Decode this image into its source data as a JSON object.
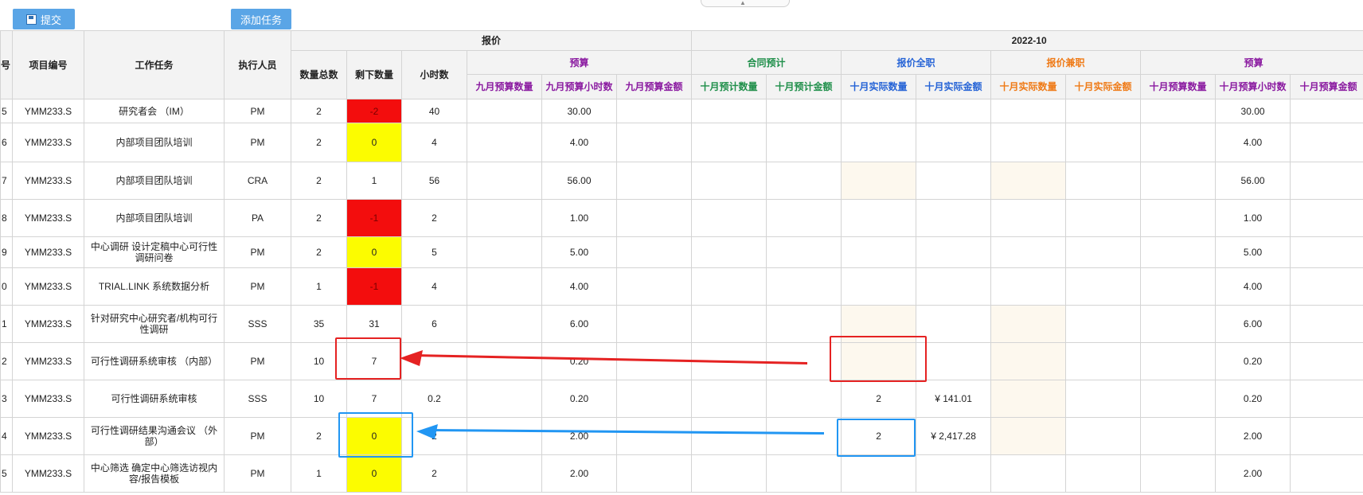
{
  "toolbar": {
    "submit_label": "提交",
    "add_task_label": "添加任务"
  },
  "header": {
    "col_no": "号",
    "col_project": "项目编号",
    "col_task": "工作任务",
    "col_exec": "执行人员",
    "group_quote": "报价",
    "group_period": "2022-10",
    "quote_total": "数量总数",
    "quote_remain": "剩下数量",
    "quote_hours": "小时数",
    "sep_budget": "预算",
    "sep_budget_count": "九月预算数量",
    "sep_budget_hours": "九月预算小时数",
    "sep_budget_amount": "九月预算金额",
    "contract_est": "合同预计",
    "oct_est_count": "十月预计数量",
    "oct_est_amount": "十月预计金额",
    "quote_fulltime": "报价全职",
    "oct_actual_count_ft": "十月实际数量",
    "oct_actual_amount_ft": "十月实际金额",
    "quote_parttime": "报价兼职",
    "oct_actual_count_pt": "十月实际数量",
    "oct_actual_amount_pt": "十月实际金额",
    "oct_budget": "预算",
    "oct_budget_count": "十月预算数量",
    "oct_budget_hours": "十月预算小时数",
    "oct_budget_amount": "十月预算金额"
  },
  "rows": [
    {
      "idx": "5",
      "project": "YMM233.S",
      "task": "研究者会 （IM）",
      "exec": "PM",
      "total": "2",
      "remain": "-2",
      "hours": "40",
      "sep_hours": "30.00",
      "ft_count": "",
      "ft_amount": "",
      "oct_hours": "30.00"
    },
    {
      "idx": "6",
      "project": "YMM233.S",
      "task": "内部项目团队培训",
      "exec": "PM",
      "total": "2",
      "remain": "0",
      "hours": "4",
      "sep_hours": "4.00",
      "ft_count": "",
      "ft_amount": "",
      "oct_hours": "4.00"
    },
    {
      "idx": "7",
      "project": "YMM233.S",
      "task": "内部项目团队培训",
      "exec": "CRA",
      "total": "2",
      "remain": "1",
      "hours": "56",
      "sep_hours": "56.00",
      "ft_count": "",
      "ft_amount": "",
      "oct_hours": "56.00"
    },
    {
      "idx": "8",
      "project": "YMM233.S",
      "task": "内部项目团队培训",
      "exec": "PA",
      "total": "2",
      "remain": "-1",
      "hours": "2",
      "sep_hours": "1.00",
      "ft_count": "",
      "ft_amount": "",
      "oct_hours": "1.00"
    },
    {
      "idx": "9",
      "project": "YMM233.S",
      "task": "中心调研 设计定稿中心可行性调研问卷",
      "exec": "PM",
      "total": "2",
      "remain": "0",
      "hours": "5",
      "sep_hours": "5.00",
      "ft_count": "",
      "ft_amount": "",
      "oct_hours": "5.00"
    },
    {
      "idx": "0",
      "project": "YMM233.S",
      "task": "TRIAL.LINK 系统数据分析",
      "exec": "PM",
      "total": "1",
      "remain": "-1",
      "hours": "4",
      "sep_hours": "4.00",
      "ft_count": "",
      "ft_amount": "",
      "oct_hours": "4.00"
    },
    {
      "idx": "1",
      "project": "YMM233.S",
      "task": "针对研究中心研究者/机构可行性调研",
      "exec": "SSS",
      "total": "35",
      "remain": "31",
      "hours": "6",
      "sep_hours": "6.00",
      "ft_count": "",
      "ft_amount": "",
      "oct_hours": "6.00"
    },
    {
      "idx": "2",
      "project": "YMM233.S",
      "task": "可行性调研系统审核 （内部）",
      "exec": "PM",
      "total": "10",
      "remain": "7",
      "hours": "",
      "sep_hours": "0.20",
      "ft_count": "",
      "ft_amount": "",
      "oct_hours": "0.20"
    },
    {
      "idx": "3",
      "project": "YMM233.S",
      "task": "可行性调研系统审核",
      "exec": "SSS",
      "total": "10",
      "remain": "7",
      "hours": "0.2",
      "sep_hours": "0.20",
      "ft_count": "2",
      "ft_amount": "¥ 141.01",
      "oct_hours": "0.20"
    },
    {
      "idx": "4",
      "project": "YMM233.S",
      "task": "可行性调研结果沟通会议 （外部）",
      "exec": "PM",
      "total": "2",
      "remain": "0",
      "hours": "2",
      "sep_hours": "2.00",
      "ft_count": "2",
      "ft_amount": "¥ 2,417.28",
      "oct_hours": "2.00"
    },
    {
      "idx": "5",
      "project": "YMM233.S",
      "task": "中心筛选 确定中心筛选访视内容/报告模板",
      "exec": "PM",
      "total": "1",
      "remain": "0",
      "hours": "2",
      "sep_hours": "2.00",
      "ft_count": "",
      "ft_amount": "",
      "oct_hours": "2.00"
    }
  ]
}
